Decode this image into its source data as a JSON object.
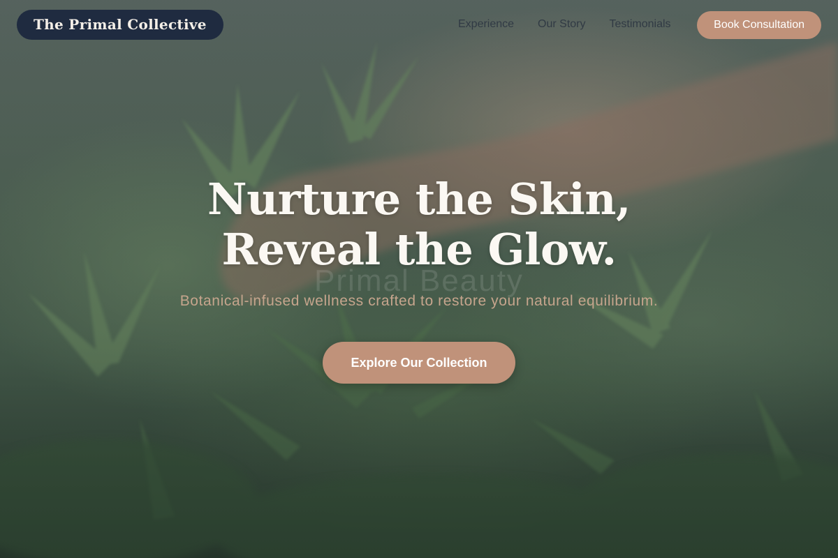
{
  "brand": {
    "name": "The Primal Collective"
  },
  "nav": {
    "links": [
      "Experience",
      "Our Story",
      "Testimonials"
    ],
    "book_label": "Book Consultation"
  },
  "hero": {
    "headline_line1": "Nurture the Skin,",
    "headline_line2": "Reveal the Glow.",
    "ghost_text": "Primal Beauty",
    "subtitle": "Botanical-infused wellness crafted to restore your natural equilibrium.",
    "cta_label": "Explore Our Collection"
  },
  "colors": {
    "accent": "#c0927a",
    "brand_pill": "#1f2b40",
    "subtitle": "#c6a58d"
  }
}
